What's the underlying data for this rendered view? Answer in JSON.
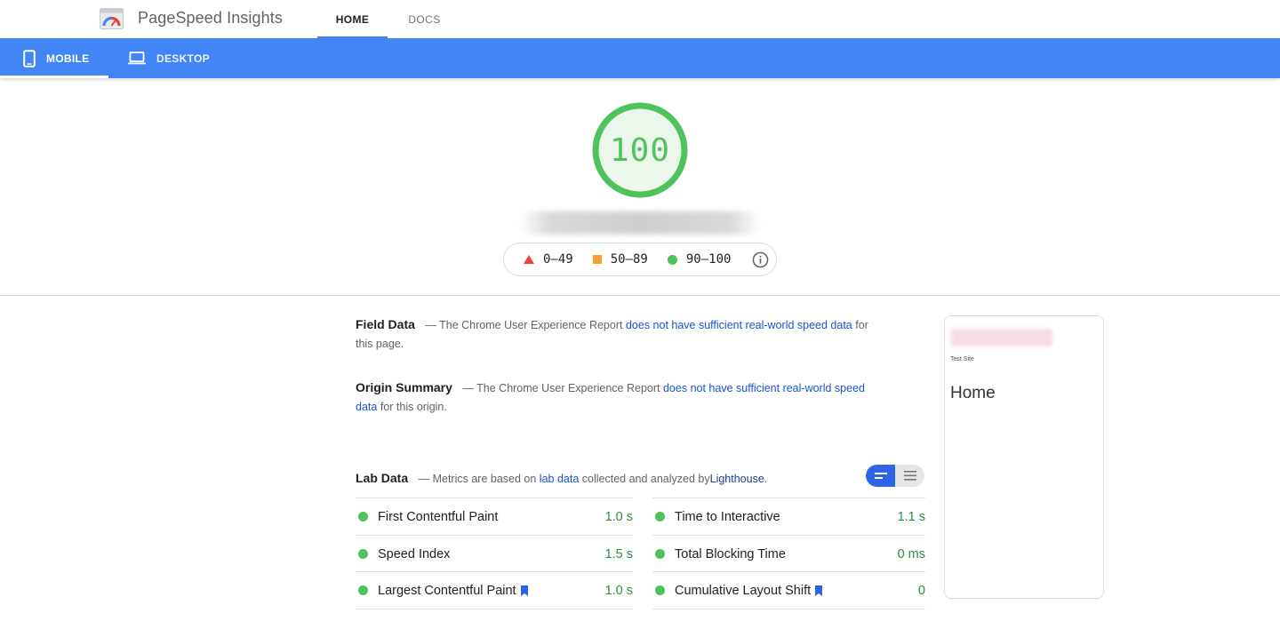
{
  "header": {
    "app_title": "PageSpeed Insights",
    "nav": [
      {
        "label": "HOME",
        "active": true
      },
      {
        "label": "DOCS",
        "active": false
      }
    ]
  },
  "device_tabs": [
    {
      "label": "MOBILE",
      "icon": "phone-icon",
      "active": true
    },
    {
      "label": "DESKTOP",
      "icon": "laptop-icon",
      "active": false
    }
  ],
  "score": {
    "value": "100",
    "color": "#4fc25b"
  },
  "legend": {
    "items": [
      {
        "label": "0–49",
        "symbol": "triangle",
        "color": "#e5443a"
      },
      {
        "label": "50–89",
        "symbol": "square",
        "color": "#f4a230"
      },
      {
        "label": "90–100",
        "symbol": "circle",
        "color": "#4fc25b"
      }
    ],
    "info_icon": "info-icon"
  },
  "field_data": {
    "title": "Field Data",
    "prefix": "— The Chrome User Experience Report",
    "link": "does not have sufficient real-world speed data",
    "suffix": "for this page."
  },
  "origin_summary": {
    "title": "Origin Summary",
    "prefix": "— The Chrome User Experience Report",
    "link": "does not have sufficient real-world speed data",
    "suffix": "for this origin."
  },
  "lab_data": {
    "title": "Lab Data",
    "prefix": "— Metrics are based on",
    "link1": "lab data",
    "middle": "collected and analyzed by",
    "link2": "Lighthouse",
    "end": "."
  },
  "metrics": [
    {
      "name": "First Contentful Paint",
      "value": "1.0 s",
      "bookmark": false
    },
    {
      "name": "Time to Interactive",
      "value": "1.1 s",
      "bookmark": false
    },
    {
      "name": "Speed Index",
      "value": "1.5 s",
      "bookmark": false
    },
    {
      "name": "Total Blocking Time",
      "value": "0 ms",
      "bookmark": false
    },
    {
      "name": "Largest Contentful Paint",
      "value": "1.0 s",
      "bookmark": true
    },
    {
      "name": "Cumulative Layout Shift",
      "value": "0",
      "bookmark": true
    }
  ],
  "preview": {
    "site_name": "Test Site",
    "heading": "Home"
  },
  "colors": {
    "accent": "#4285f4",
    "pass": "#4fc25b",
    "link": "#1a55c9"
  }
}
